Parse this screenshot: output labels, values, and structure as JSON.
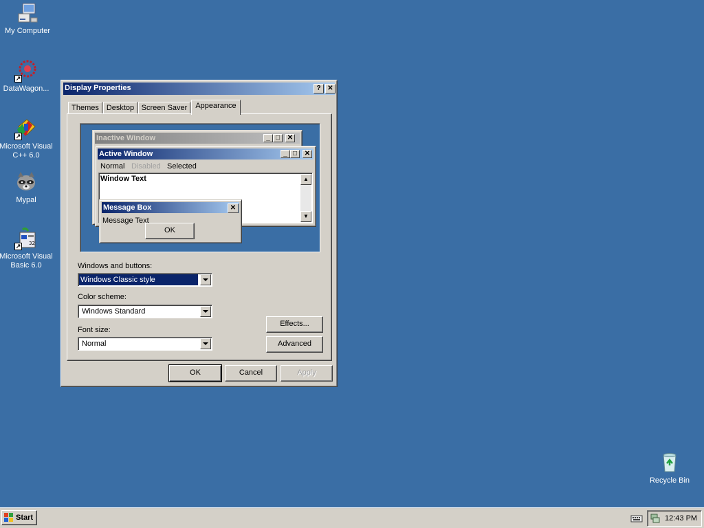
{
  "desktop": {
    "icons": [
      {
        "label": "My Computer"
      },
      {
        "label": "DataWagon..."
      },
      {
        "label": "Microsoft Visual C++ 6.0"
      },
      {
        "label": "Mypal"
      },
      {
        "label": "Microsoft Visual Basic 6.0"
      },
      {
        "label": "Recycle Bin"
      }
    ]
  },
  "dialog": {
    "title": "Display Properties",
    "help_button": "?",
    "close_button": "✕",
    "tabs": [
      {
        "label": "Themes"
      },
      {
        "label": "Desktop"
      },
      {
        "label": "Screen Saver"
      },
      {
        "label": "Appearance",
        "active": true
      }
    ],
    "preview": {
      "inactive_title": "Inactive Window",
      "active_title": "Active Window",
      "menu": {
        "normal": "Normal",
        "disabled": "Disabled",
        "selected": "Selected"
      },
      "window_text": "Window Text",
      "message_box_title": "Message Box",
      "message_text": "Message Text",
      "ok_label": "OK"
    },
    "windows_buttons_label": "Windows and buttons:",
    "windows_buttons_value": "Windows Classic style",
    "color_scheme_label": "Color scheme:",
    "color_scheme_value": "Windows Standard",
    "font_size_label": "Font size:",
    "font_size_value": "Normal",
    "effects_label": "Effects...",
    "advanced_label": "Advanced",
    "ok_label": "OK",
    "cancel_label": "Cancel",
    "apply_label": "Apply"
  },
  "taskbar": {
    "start_label": "Start",
    "clock": "12:43 PM"
  },
  "colors": {
    "desktop": "#3a6ea5",
    "active_title_start": "#0a246a",
    "active_title_end": "#a6caf0",
    "inactive_title_start": "#808080",
    "inactive_title_end": "#c0c0c0",
    "face": "#d4d0c8",
    "selection": "#0a246a"
  }
}
